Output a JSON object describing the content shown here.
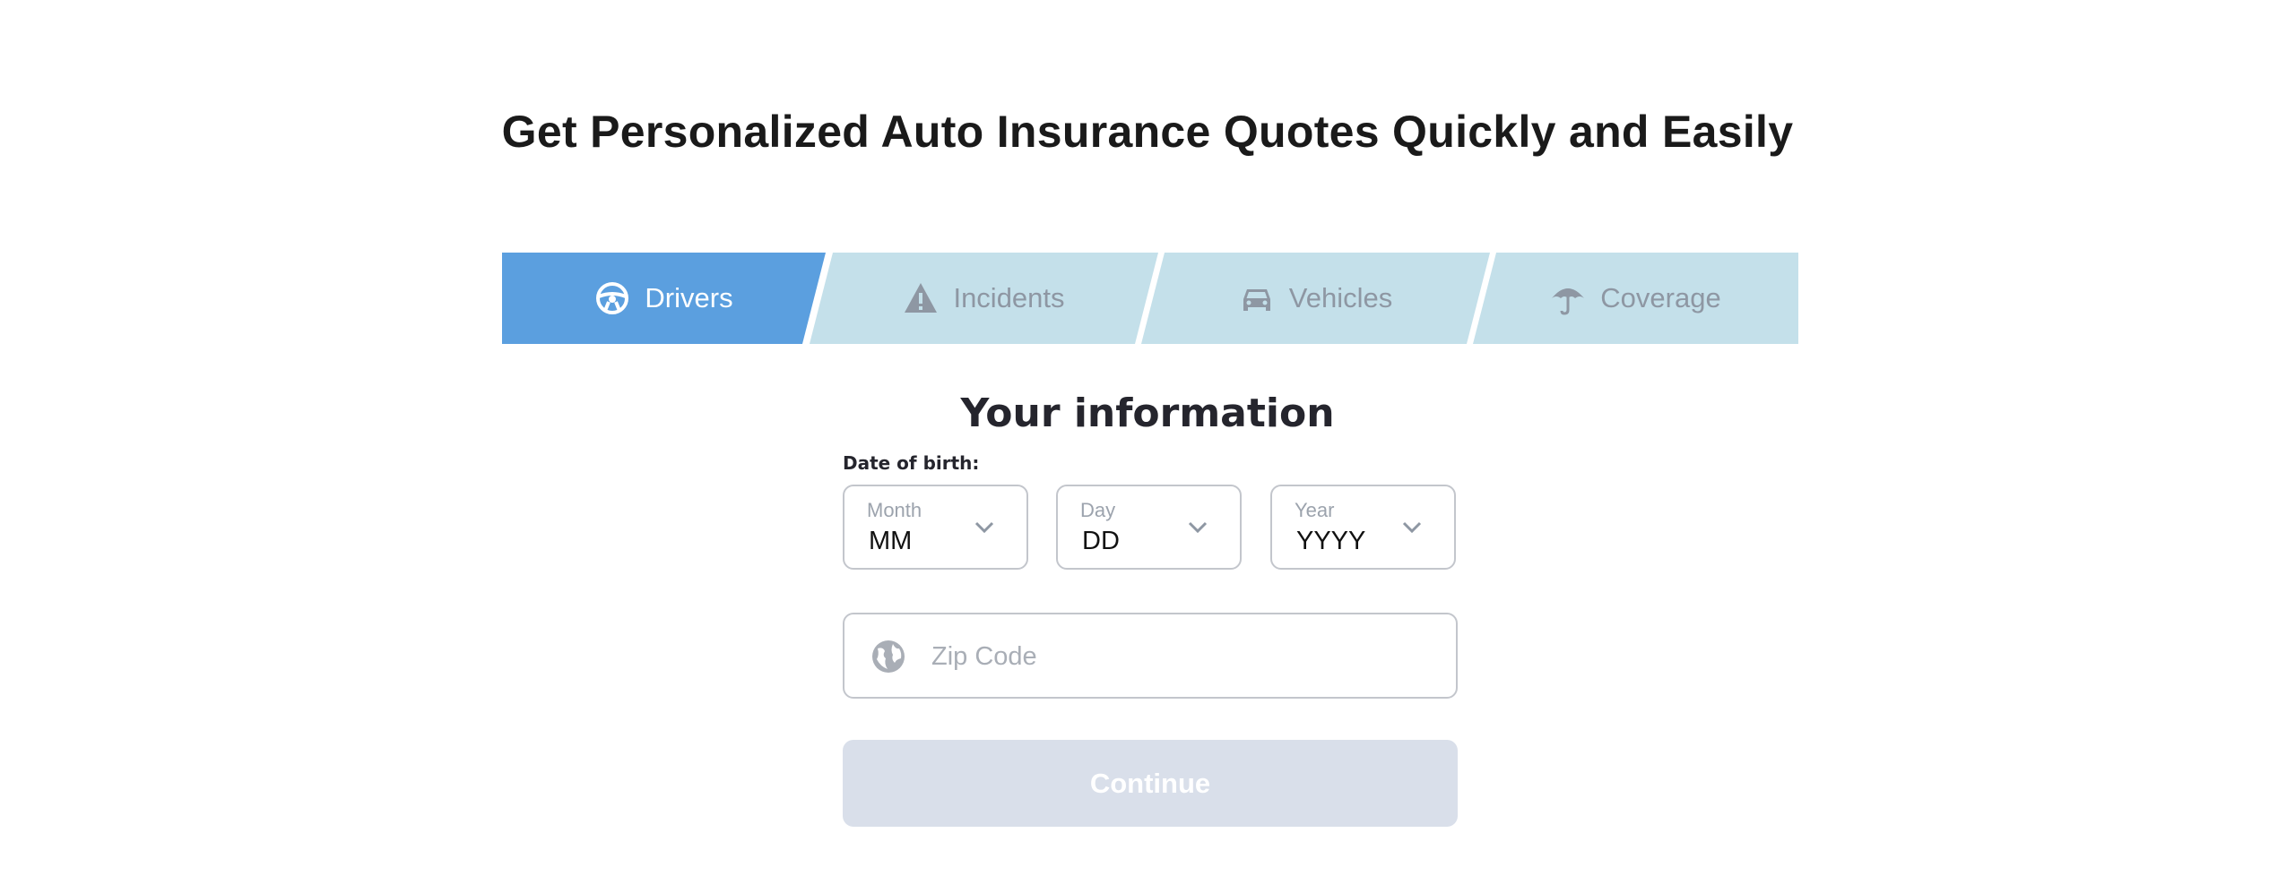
{
  "headline": "Get Personalized Auto Insurance Quotes Quickly and Easily",
  "steps": [
    {
      "label": "Drivers",
      "icon": "steering-wheel-icon",
      "active": true
    },
    {
      "label": "Incidents",
      "icon": "warning-icon",
      "active": false
    },
    {
      "label": "Vehicles",
      "icon": "car-icon",
      "active": false
    },
    {
      "label": "Coverage",
      "icon": "umbrella-icon",
      "active": false
    }
  ],
  "form": {
    "title": "Your information",
    "dob_label": "Date of birth:",
    "month": {
      "label": "Month",
      "value": "MM"
    },
    "day": {
      "label": "Day",
      "value": "DD"
    },
    "year": {
      "label": "Year",
      "value": "YYYY"
    },
    "zip_placeholder": "Zip Code",
    "continue_label": "Continue"
  },
  "colors": {
    "active_step": "#5b9fdf",
    "inactive_step": "#c4e0ea",
    "button_disabled": "#d9dfea"
  }
}
